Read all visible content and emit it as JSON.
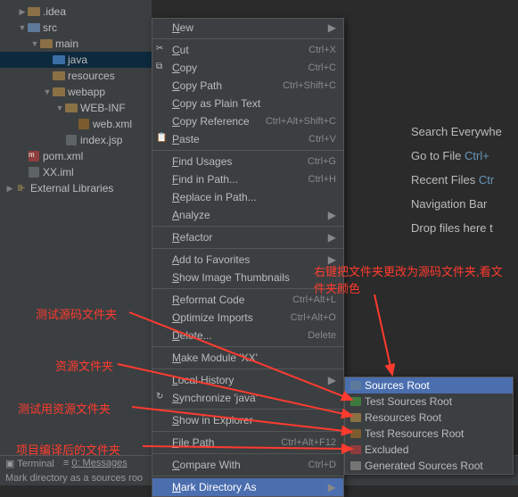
{
  "tree": {
    "items": [
      {
        "indent": 1,
        "arrow": "right",
        "icon": "folder",
        "label": ".idea"
      },
      {
        "indent": 1,
        "arrow": "down",
        "icon": "folder-src",
        "label": "src"
      },
      {
        "indent": 2,
        "arrow": "down",
        "icon": "folder",
        "label": "main"
      },
      {
        "indent": 3,
        "arrow": "",
        "icon": "folder-blue",
        "label": "java",
        "selected": true
      },
      {
        "indent": 3,
        "arrow": "",
        "icon": "folder",
        "label": "resources"
      },
      {
        "indent": 3,
        "arrow": "down",
        "icon": "folder",
        "label": "webapp"
      },
      {
        "indent": 4,
        "arrow": "down",
        "icon": "folder",
        "label": "WEB-INF"
      },
      {
        "indent": 5,
        "arrow": "",
        "icon": "file-x",
        "label": "web.xml"
      },
      {
        "indent": 4,
        "arrow": "",
        "icon": "file",
        "label": "index.jsp"
      },
      {
        "indent": 1,
        "arrow": "",
        "icon": "file-m",
        "label": "pom.xml"
      },
      {
        "indent": 1,
        "arrow": "",
        "icon": "file",
        "label": "XX.iml"
      },
      {
        "indent": 0,
        "arrow": "right",
        "icon": "lib",
        "label": "External Libraries"
      }
    ]
  },
  "menu": {
    "groups": [
      [
        {
          "label": "New",
          "sub": true
        }
      ],
      [
        {
          "icon": "cut",
          "label": "Cut",
          "shortcut": "Ctrl+X"
        },
        {
          "icon": "copy",
          "label": "Copy",
          "shortcut": "Ctrl+C"
        },
        {
          "label": "Copy Path",
          "shortcut": "Ctrl+Shift+C"
        },
        {
          "label": "Copy as Plain Text"
        },
        {
          "label": "Copy Reference",
          "shortcut": "Ctrl+Alt+Shift+C"
        },
        {
          "icon": "paste",
          "label": "Paste",
          "shortcut": "Ctrl+V"
        }
      ],
      [
        {
          "label": "Find Usages",
          "shortcut": "Ctrl+G"
        },
        {
          "label": "Find in Path...",
          "shortcut": "Ctrl+H"
        },
        {
          "label": "Replace in Path..."
        },
        {
          "label": "Analyze",
          "sub": true
        }
      ],
      [
        {
          "label": "Refactor",
          "sub": true
        }
      ],
      [
        {
          "label": "Add to Favorites",
          "sub": true
        },
        {
          "label": "Show Image Thumbnails"
        }
      ],
      [
        {
          "label": "Reformat Code",
          "shortcut": "Ctrl+Alt+L"
        },
        {
          "label": "Optimize Imports",
          "shortcut": "Ctrl+Alt+O"
        },
        {
          "label": "Delete...",
          "shortcut": "Delete"
        }
      ],
      [
        {
          "label": "Make Module 'XX'"
        }
      ],
      [
        {
          "label": "Local History",
          "sub": true
        },
        {
          "icon": "sync",
          "label": "Synchronize 'java'"
        }
      ],
      [
        {
          "label": "Show in Explorer"
        }
      ],
      [
        {
          "label": "File Path",
          "shortcut": "Ctrl+Alt+F12"
        }
      ],
      [
        {
          "label": "Compare With",
          "shortcut": "Ctrl+D"
        }
      ],
      [
        {
          "label": "Mark Directory As",
          "sub": true,
          "highlighted": true
        }
      ]
    ]
  },
  "submenu": {
    "items": [
      {
        "color": "#5e7a9b",
        "label": "Sources Root",
        "highlighted": true
      },
      {
        "color": "#3d7a3d",
        "label": "Test Sources Root"
      },
      {
        "color": "#8a7145",
        "label": "Resources Root"
      },
      {
        "color": "#7a5c2e",
        "label": "Test Resources Root"
      },
      {
        "color": "#8e3c3c",
        "label": "Excluded"
      },
      {
        "color": "#747474",
        "label": "Generated Sources Root"
      }
    ]
  },
  "hints": {
    "search": "Search Everywhe",
    "gotofile": "Go to File",
    "gotofile_key": "Ctrl+",
    "recent": "Recent Files",
    "recent_key": "Ctr",
    "navbar": "Navigation Bar",
    "drop": "Drop files here t"
  },
  "annotations": {
    "top_right": "右键把文件夹更改为源码文件夹,看文件夹颜色",
    "a1": "测试源码文件夹",
    "a2": "资源文件夹",
    "a3": "测试用资源文件夹",
    "a4": "项目编译后的文件夹"
  },
  "bottom": {
    "terminal": "Terminal",
    "messages": "0: Messages",
    "status": "Mark directory as a sources roo"
  }
}
